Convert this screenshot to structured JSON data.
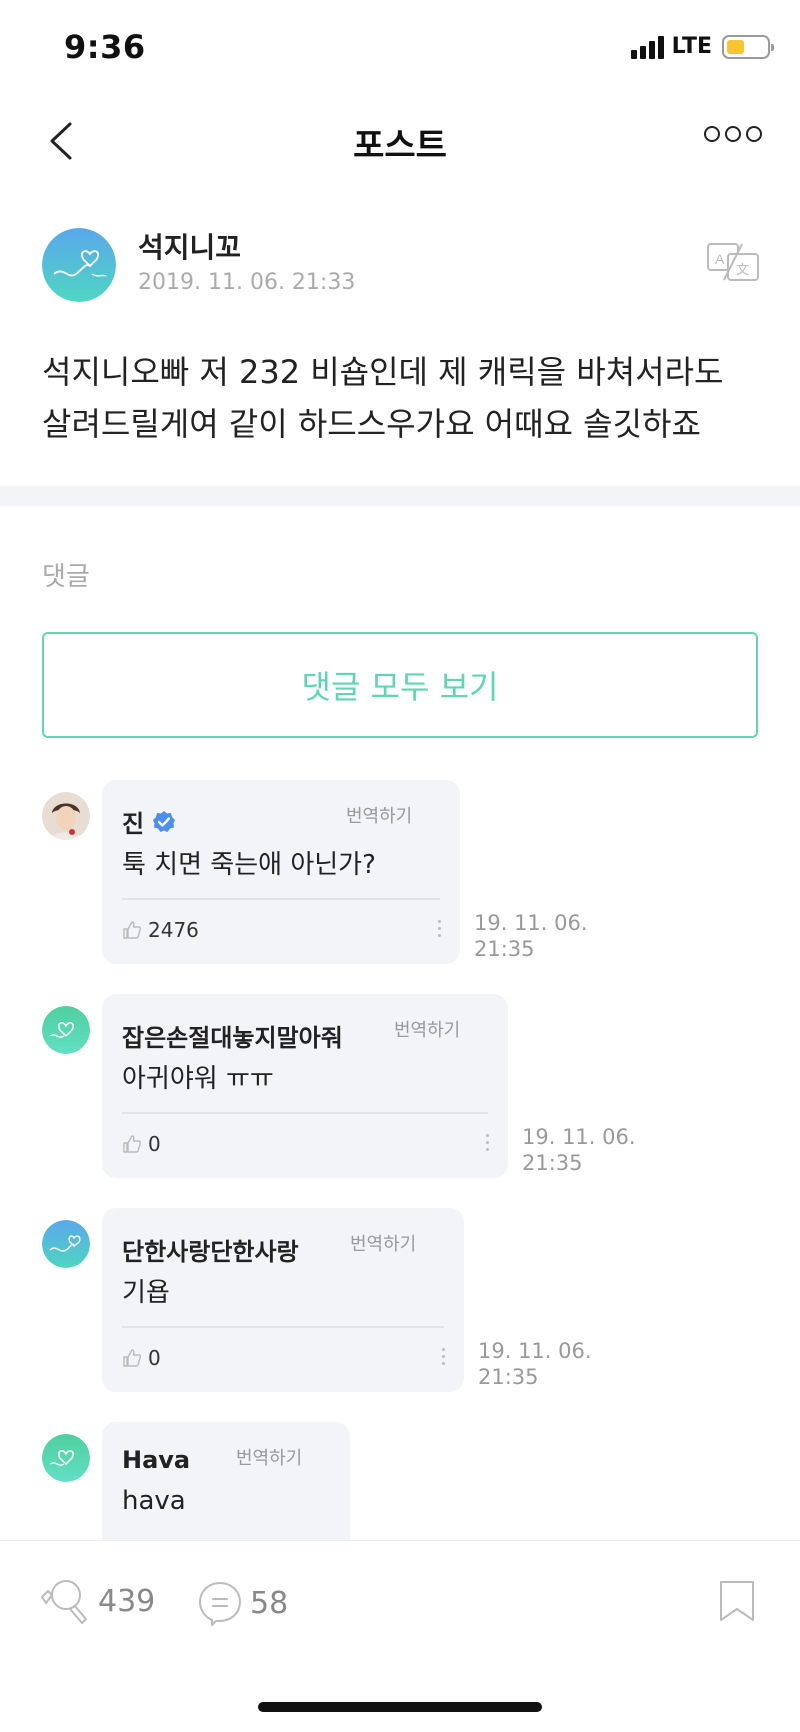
{
  "status_bar": {
    "time": "9:36",
    "network": "LTE",
    "battery_level": 0.45,
    "battery_color": "#f7c62f"
  },
  "nav": {
    "title": "포스트"
  },
  "post": {
    "author": "석지니꼬",
    "date": "2019. 11. 06. 21:33",
    "body": "석지니오빠 저 232 비숍인데 제 캐릭을 바쳐서라도 살려드릴게여 같이 하드스우가요 어때요 솔깃하죠"
  },
  "comments_section": {
    "label": "댓글",
    "view_all_label": "댓글 모두 보기"
  },
  "comments": [
    {
      "name": "진",
      "verified": true,
      "translate_label": "번역하기",
      "text": "툭 치면 죽는애 아닌가?",
      "likes": "2476",
      "time_line1": "19. 11. 06.",
      "time_line2": "21:35"
    },
    {
      "name": "잡은손절대놓지말아줘",
      "verified": false,
      "translate_label": "번역하기",
      "text": "아귀야워 ㅠㅠ",
      "likes": "0",
      "time_line1": "19. 11. 06.",
      "time_line2": "21:35"
    },
    {
      "name": "단한사랑단한사랑",
      "verified": false,
      "translate_label": "번역하기",
      "text": "기욥",
      "likes": "0",
      "time_line1": "19. 11. 06.",
      "time_line2": "21:35"
    },
    {
      "name": "Hava",
      "verified": false,
      "translate_label": "번역하기",
      "text": "hava"
    }
  ],
  "bottom_bar": {
    "like_count": "439",
    "comment_count": "58"
  },
  "colors": {
    "accent": "#5fd5b2",
    "bubble_bg": "#f3f4f7",
    "verified": "#4a8ef0"
  },
  "icons": [
    "back-icon",
    "more-icon",
    "translate-icon",
    "verified-icon",
    "thumbs-up-icon",
    "more-vertical-icon",
    "lightstick-icon",
    "comment-icon",
    "bookmark-icon"
  ]
}
